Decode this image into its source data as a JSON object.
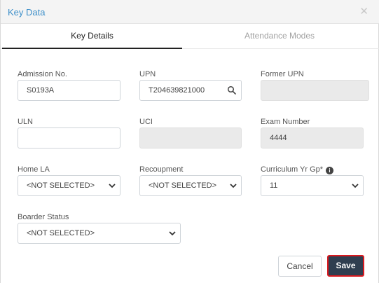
{
  "dialog": {
    "title": "Key Data"
  },
  "tabs": [
    {
      "label": "Key Details",
      "active": true
    },
    {
      "label": "Attendance Modes",
      "active": false
    }
  ],
  "fields": {
    "admission_no": {
      "label": "Admission No.",
      "value": "S0193A"
    },
    "upn": {
      "label": "UPN",
      "value": "T204639821000"
    },
    "former_upn": {
      "label": "Former UPN",
      "value": ""
    },
    "uln": {
      "label": "ULN",
      "value": ""
    },
    "uci": {
      "label": "UCI",
      "value": ""
    },
    "exam_number": {
      "label": "Exam Number",
      "value": "4444"
    },
    "home_la": {
      "label": "Home LA",
      "value": "<NOT SELECTED>"
    },
    "recoupment": {
      "label": "Recoupment",
      "value": "<NOT SELECTED>"
    },
    "curriculum_yr_gp": {
      "label": "Curriculum Yr Gp*",
      "value": "11"
    },
    "boarder_status": {
      "label": "Boarder Status",
      "value": "<NOT SELECTED>"
    }
  },
  "buttons": {
    "cancel": "Cancel",
    "save": "Save"
  },
  "icons": {
    "close": "close-icon",
    "search": "search-icon",
    "info": "info-icon",
    "dropdown": "chevron-down-icon"
  },
  "colors": {
    "title": "#3d8fc9",
    "save_bg": "#2f3e50",
    "highlight": "#d9191f",
    "disabled_bg": "#eaeaea"
  }
}
